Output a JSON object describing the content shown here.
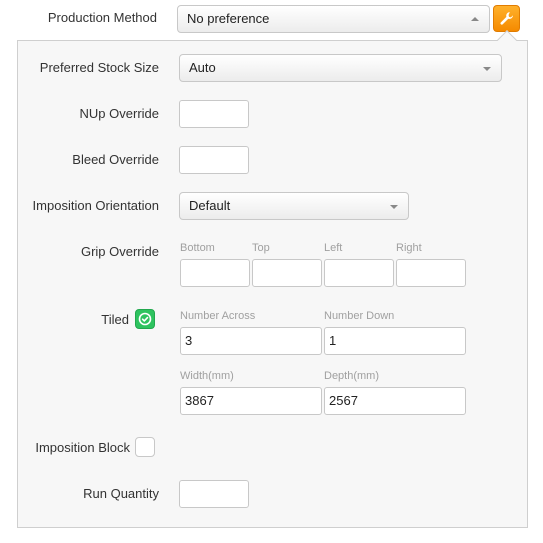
{
  "production_method": {
    "label": "Production Method",
    "value": "No preference"
  },
  "panel": {
    "preferred_stock_size": {
      "label": "Preferred Stock Size",
      "value": "Auto"
    },
    "nup_override": {
      "label": "NUp Override",
      "value": ""
    },
    "bleed_override": {
      "label": "Bleed Override",
      "value": ""
    },
    "imposition_orientation": {
      "label": "Imposition Orientation",
      "value": "Default"
    },
    "grip_override": {
      "label": "Grip Override",
      "bottom_label": "Bottom",
      "top_label": "Top",
      "left_label": "Left",
      "right_label": "Right",
      "bottom": "",
      "top": "",
      "left": "",
      "right": ""
    },
    "tiled": {
      "label": "Tiled",
      "checked": true,
      "number_across_label": "Number Across",
      "number_across": "3",
      "number_down_label": "Number Down",
      "number_down": "1",
      "width_label": "Width(mm)",
      "width": "3867",
      "depth_label": "Depth(mm)",
      "depth": "2567"
    },
    "imposition_block": {
      "label": "Imposition Block",
      "checked": false
    },
    "run_quantity": {
      "label": "Run Quantity",
      "value": ""
    }
  },
  "colors": {
    "accent": "#f7941d",
    "check": "#2ec35f",
    "panel_bg": "#f7f7f7",
    "border": "#c8c8c8"
  },
  "icons": {
    "settings_button": "wrench-icon",
    "tiled_checkbox": "check-icon"
  }
}
